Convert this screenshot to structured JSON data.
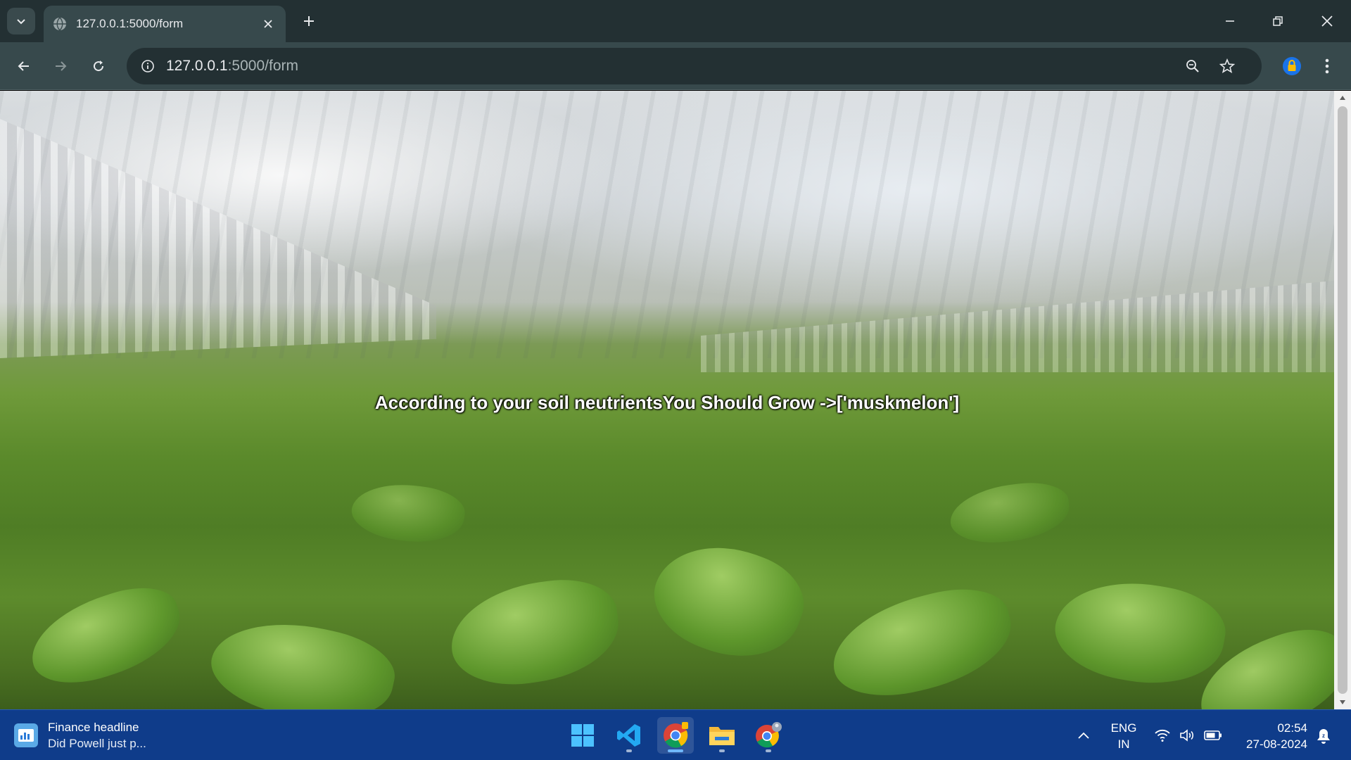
{
  "browser": {
    "tab": {
      "title": "127.0.0.1:5000/form",
      "favicon": "globe-icon"
    },
    "address": {
      "host": "127.0.0.1",
      "path": ":5000/form"
    },
    "toolbar_icons": [
      "back-icon",
      "forward-icon",
      "reload-icon",
      "site-info-icon",
      "zoom-icon",
      "bookmark-star-icon",
      "extension-lock-icon",
      "more-vert-icon"
    ],
    "window_controls": [
      "minimize-icon",
      "restore-icon",
      "close-icon"
    ]
  },
  "page": {
    "result_text": "According to your soil neutrientsYou Should Grow ->['muskmelon']"
  },
  "taskbar": {
    "widget": {
      "title": "Finance headline",
      "subtitle": "Did Powell just p..."
    },
    "apps": [
      "windows-start-icon",
      "vscode-icon",
      "chrome-icon",
      "file-explorer-icon",
      "chrome-profile-icon"
    ],
    "tray": {
      "lang_line1": "ENG",
      "lang_line2": "IN",
      "time": "02:54",
      "date": "27-08-2024"
    }
  },
  "colors": {
    "tabstrip": "#233033",
    "toolbar": "#37494c",
    "taskbar": "#0f3c8a",
    "result_text": "#ffffff"
  }
}
